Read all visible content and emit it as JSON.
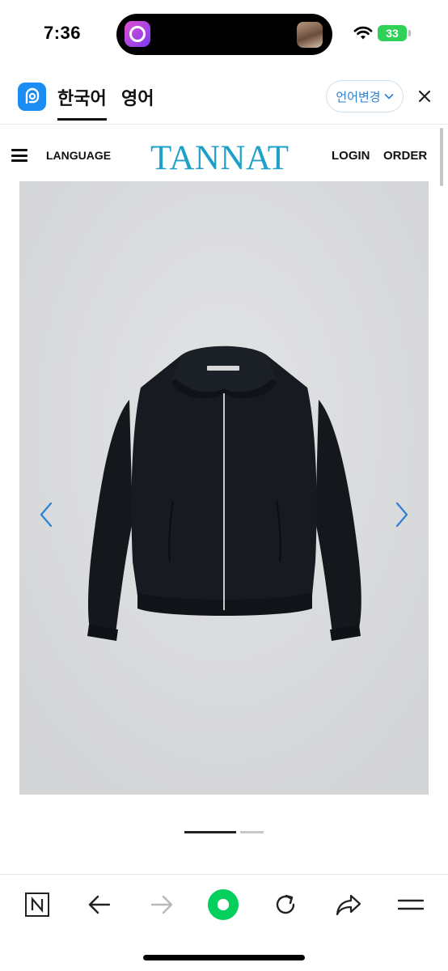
{
  "status_bar": {
    "time": "7:36",
    "battery": "33",
    "icons": [
      "photo-editor-app-icon",
      "music-thumbnail",
      "wifi-icon",
      "charging-battery-icon"
    ]
  },
  "translator": {
    "source_tab": "한국어",
    "target_tab": "영어",
    "change_label": "언어변경",
    "icons": [
      "papago-logo-icon",
      "chevron-down-icon",
      "close-icon"
    ]
  },
  "site": {
    "menu_label": "LANGUAGE",
    "logo": "TANNAT",
    "login_label": "LOGIN",
    "order_label": "ORDER",
    "logo_color": "#1ea0c8"
  },
  "gallery": {
    "image_description_icon": "jacket-product-image",
    "total_slides_indicator": 2,
    "active_slide": 1,
    "arrow_color": "#2d7fcf"
  },
  "toolbar": {
    "icons": [
      "n-home-icon",
      "back-arrow-icon",
      "forward-arrow-icon",
      "green-dot-icon",
      "refresh-icon",
      "share-icon",
      "menu-icon"
    ]
  }
}
